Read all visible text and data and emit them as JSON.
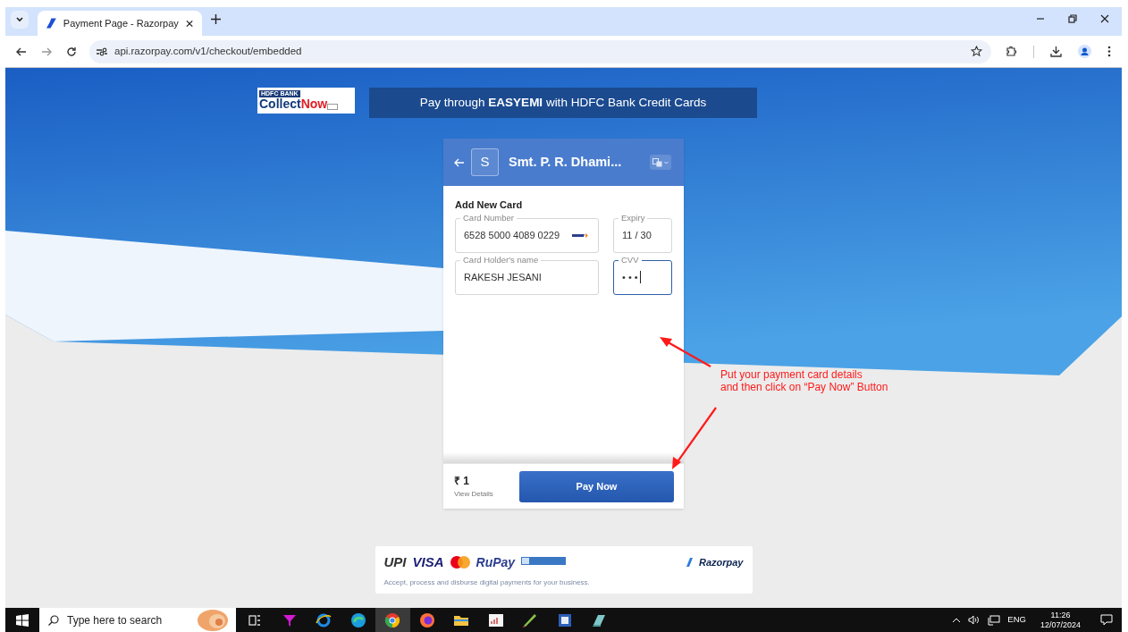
{
  "browser": {
    "tab_title": "Payment Page - Razorpay",
    "address": "api.razorpay.com/v1/checkout/embedded"
  },
  "banner": {
    "logo_bank": "HDFC BANK",
    "logo_words": [
      "Collect",
      "Now"
    ],
    "text": "Pay through **EASYEMI** with HDFC Bank Credit Cards"
  },
  "checkout": {
    "merchant_initial": "S",
    "merchant_name": "Smt. P. R. Dhami...",
    "section_title": "Add New Card",
    "fields": [
      {
        "label": "Card Number",
        "value": "6528 5000 4089 0229",
        "kind": "card",
        "focused": false
      },
      {
        "label": "Expiry",
        "value": "11 / 30",
        "kind": "short",
        "focused": false
      },
      {
        "label": "Card Holder's name",
        "value": "RAKESH JESANI",
        "kind": "text",
        "focused": false
      },
      {
        "label": "CVV",
        "value": "• • •",
        "kind": "short",
        "focused": true
      }
    ],
    "amount": "₹ 1",
    "details_link": "View Details",
    "pay_button": "Pay Now"
  },
  "footer": {
    "logos": [
      "UPI",
      "VISA",
      "RuPay"
    ],
    "brand": "Razorpay",
    "tagline": "Accept, process and disburse digital payments for your business."
  },
  "annotation": {
    "lines": [
      "Put your payment card details",
      "and then click on “Pay Now” Button"
    ]
  },
  "taskbar": {
    "search_placeholder": "Type here to search",
    "apps": [
      {
        "kind": "taskview",
        "selected": false
      },
      {
        "kind": "funnel",
        "selected": false
      },
      {
        "kind": "ie",
        "selected": false
      },
      {
        "kind": "edge",
        "selected": false
      },
      {
        "kind": "chrome",
        "selected": true
      },
      {
        "kind": "firefox",
        "selected": false
      },
      {
        "kind": "folder",
        "selected": false
      },
      {
        "kind": "chart",
        "selected": false
      },
      {
        "kind": "paint",
        "selected": false
      },
      {
        "kind": "doc",
        "selected": false
      },
      {
        "kind": "book",
        "selected": false
      }
    ],
    "language": "ENG",
    "time": "11:26",
    "date": "12/07/2024"
  }
}
